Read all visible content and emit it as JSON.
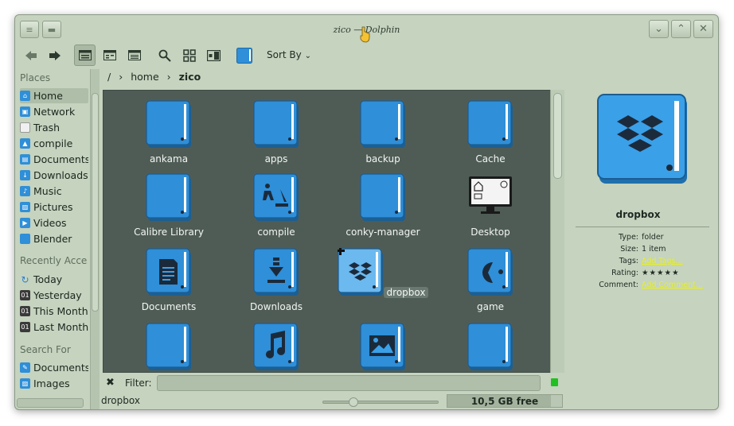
{
  "window": {
    "title": "zico — Dolphin"
  },
  "toolbar": {
    "sort_by_label": "Sort By"
  },
  "breadcrumb": {
    "root": "/",
    "parts": [
      "home",
      "zico"
    ]
  },
  "sidebar": {
    "places_title": "Places",
    "places": [
      {
        "label": "Home",
        "icon": "home-icon"
      },
      {
        "label": "Network",
        "icon": "network-icon"
      },
      {
        "label": "Trash",
        "icon": "trash-icon"
      },
      {
        "label": "compile",
        "icon": "folder-icon"
      },
      {
        "label": "Documents",
        "icon": "documents-icon"
      },
      {
        "label": "Downloads",
        "icon": "downloads-icon"
      },
      {
        "label": "Music",
        "icon": "music-icon"
      },
      {
        "label": "Pictures",
        "icon": "pictures-icon"
      },
      {
        "label": "Videos",
        "icon": "videos-icon"
      },
      {
        "label": "Blender",
        "icon": "folder-icon"
      }
    ],
    "recent_title": "Recently Accessed",
    "recent": [
      {
        "label": "Today",
        "icon": "today-icon"
      },
      {
        "label": "Yesterday",
        "icon": "calendar-icon"
      },
      {
        "label": "This Month",
        "icon": "calendar-icon"
      },
      {
        "label": "Last Month",
        "icon": "calendar-icon"
      }
    ],
    "search_title": "Search For",
    "search": [
      {
        "label": "Documents",
        "icon": "documents-icon"
      },
      {
        "label": "Images",
        "icon": "images-icon"
      }
    ]
  },
  "files": [
    {
      "label": "ankama",
      "icon": "folder"
    },
    {
      "label": "apps",
      "icon": "folder"
    },
    {
      "label": "backup",
      "icon": "folder"
    },
    {
      "label": "Cache",
      "icon": "folder"
    },
    {
      "label": "Calibre Library",
      "icon": "folder"
    },
    {
      "label": "compile",
      "icon": "folder-construction"
    },
    {
      "label": "conky-manager",
      "icon": "folder"
    },
    {
      "label": "Desktop",
      "icon": "desktop"
    },
    {
      "label": "Documents",
      "icon": "folder-documents"
    },
    {
      "label": "Downloads",
      "icon": "folder-downloads"
    },
    {
      "label": "dropbox",
      "icon": "folder-dropbox"
    },
    {
      "label": "game",
      "icon": "folder-game"
    },
    {
      "label": "",
      "icon": "folder"
    },
    {
      "label": "",
      "icon": "folder-music"
    },
    {
      "label": "",
      "icon": "folder-pictures"
    },
    {
      "label": "",
      "icon": "folder"
    }
  ],
  "info": {
    "name": "dropbox",
    "type_key": "Type:",
    "type_val": "folder",
    "size_key": "Size:",
    "size_val": "1 item",
    "tags_key": "Tags:",
    "tags_val": "Add Tags...",
    "rating_key": "Rating:",
    "rating_val": "★★★★★",
    "comment_key": "Comment:",
    "comment_val": "Add Comment..."
  },
  "filter": {
    "label": "Filter:",
    "value": ""
  },
  "status": {
    "selection": "dropbox",
    "free_space": "10,5 GB free",
    "used_fraction": 0.9
  },
  "colors": {
    "folder_blue": "#2f8fd8",
    "link_yellow": "#e8f020",
    "view_bg": "#4f5c56"
  }
}
